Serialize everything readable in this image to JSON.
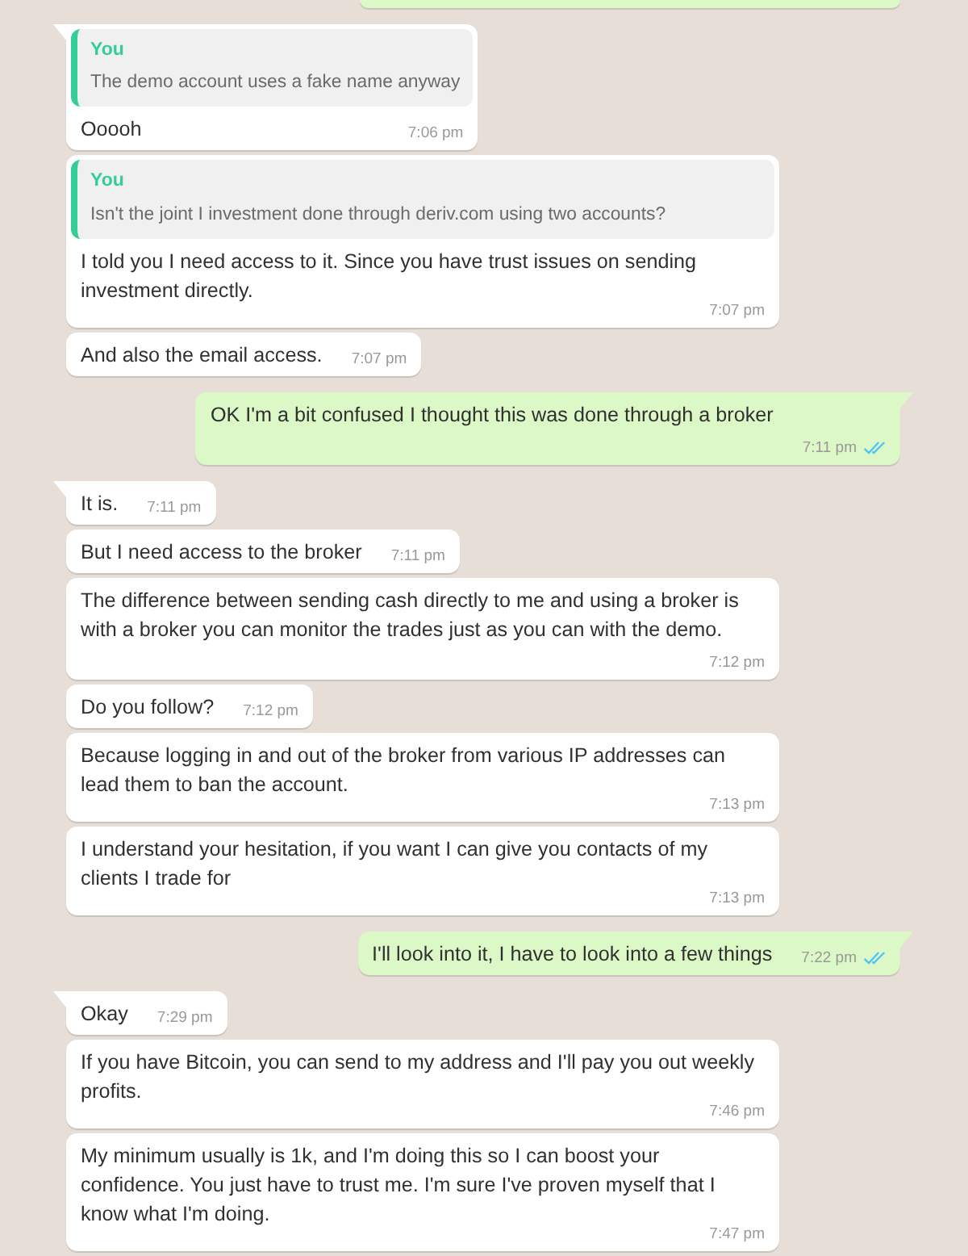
{
  "messages": [
    {
      "kind": "clipped",
      "outgoing": true
    },
    {
      "outgoing": false,
      "tail": true,
      "quote": {
        "author": "You",
        "text": "The demo account uses a fake name anyway"
      },
      "text": "Ooooh",
      "time": "7:06 pm"
    },
    {
      "outgoing": false,
      "tail": false,
      "quote": {
        "author": "You",
        "text": "Isn't the joint I investment done through deriv.com using two accounts?"
      },
      "text": "I told you I need access to it. Since you have trust issues on sending investment directly.",
      "time": "7:07 pm"
    },
    {
      "outgoing": false,
      "tail": false,
      "text": "And also the email access.",
      "time": "7:07 pm"
    },
    {
      "outgoing": true,
      "tail": true,
      "text": "OK I'm a bit confused I thought this was done through a broker",
      "time": "7:11 pm",
      "read": true,
      "stacked": true
    },
    {
      "outgoing": false,
      "tail": true,
      "text": "It is.",
      "time": "7:11 pm"
    },
    {
      "outgoing": false,
      "tail": false,
      "text": "But I need access to the broker",
      "time": "7:11 pm"
    },
    {
      "outgoing": false,
      "tail": false,
      "text": "The difference between sending cash directly to me and using a broker is with a broker you can monitor the trades just as you can with the demo.",
      "time": "7:12 pm",
      "stacked": true
    },
    {
      "outgoing": false,
      "tail": false,
      "text": "Do you follow?",
      "time": "7:12 pm"
    },
    {
      "outgoing": false,
      "tail": false,
      "text": "Because logging in and out of the broker from various IP addresses can lead them to ban the account.",
      "time": "7:13 pm"
    },
    {
      "outgoing": false,
      "tail": false,
      "text": "I understand your hesitation, if you want I can give you contacts of my clients I trade for",
      "time": "7:13 pm"
    },
    {
      "outgoing": true,
      "tail": true,
      "text": "I'll look into it, I have to look into a few things",
      "time": "7:22 pm",
      "read": true
    },
    {
      "outgoing": false,
      "tail": true,
      "text": "Okay",
      "time": "7:29 pm"
    },
    {
      "outgoing": false,
      "tail": false,
      "text": "If you have Bitcoin, you can send to my address and I'll pay you out weekly profits.",
      "time": "7:46 pm"
    },
    {
      "outgoing": false,
      "tail": false,
      "text": "My minimum usually is 1k, and I'm doing this so I can boost your confidence. You just have to trust me. I'm sure I've proven myself that I know what I'm doing.",
      "time": "7:47 pm"
    }
  ]
}
